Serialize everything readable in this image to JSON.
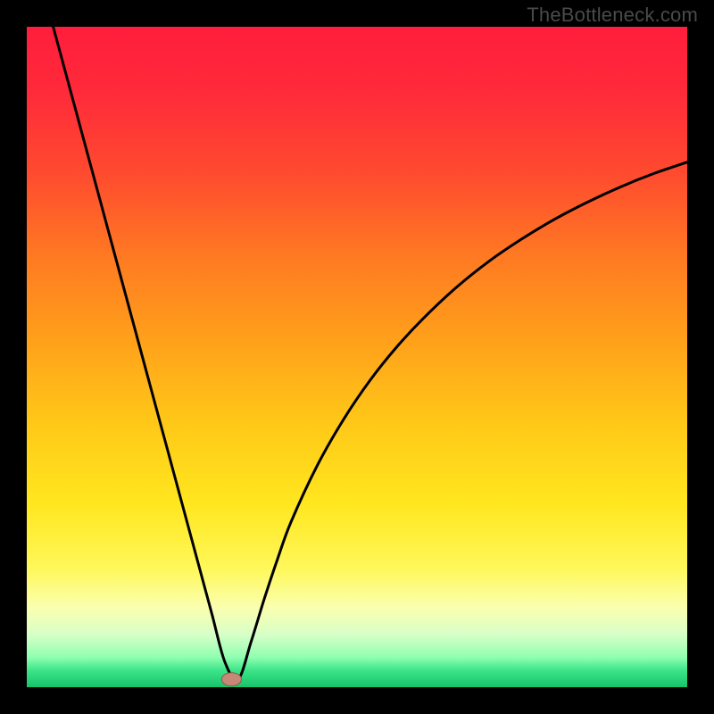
{
  "watermark": "TheBottleneck.com",
  "colors": {
    "gradient_stops": [
      {
        "offset": 0.0,
        "color": "#ff1e3c"
      },
      {
        "offset": 0.1,
        "color": "#ff2a3a"
      },
      {
        "offset": 0.22,
        "color": "#ff4a2f"
      },
      {
        "offset": 0.35,
        "color": "#ff7a22"
      },
      {
        "offset": 0.48,
        "color": "#ffa21a"
      },
      {
        "offset": 0.6,
        "color": "#ffc818"
      },
      {
        "offset": 0.72,
        "color": "#ffe61e"
      },
      {
        "offset": 0.82,
        "color": "#fff85a"
      },
      {
        "offset": 0.88,
        "color": "#faffb0"
      },
      {
        "offset": 0.92,
        "color": "#d8ffc8"
      },
      {
        "offset": 0.955,
        "color": "#8effb0"
      },
      {
        "offset": 0.975,
        "color": "#3be488"
      },
      {
        "offset": 1.0,
        "color": "#17c36b"
      }
    ],
    "curve": "#000000",
    "marker_fill": "#c88878",
    "marker_stroke": "#8e5a4a",
    "background": "#000000"
  },
  "chart_data": {
    "type": "line",
    "title": "",
    "xlabel": "",
    "ylabel": "",
    "xlim": [
      0,
      100
    ],
    "ylim": [
      0,
      100
    ],
    "grid": false,
    "legend_position": "none",
    "series": [
      {
        "name": "bottleneck-curve",
        "x": [
          4,
          6,
          8,
          10,
          12,
          14,
          16,
          18,
          20,
          22,
          24,
          26,
          28,
          30,
          32,
          34,
          36,
          38,
          40,
          44,
          48,
          52,
          56,
          60,
          65,
          70,
          75,
          80,
          85,
          90,
          95,
          100
        ],
        "y": [
          100,
          92.6,
          85.2,
          77.8,
          70.4,
          63.0,
          55.6,
          48.2,
          40.8,
          33.4,
          26.0,
          18.6,
          11.2,
          3.8,
          1.2,
          7.0,
          13.5,
          19.5,
          25.0,
          33.6,
          40.6,
          46.5,
          51.5,
          55.8,
          60.5,
          64.5,
          67.9,
          70.9,
          73.5,
          75.8,
          77.8,
          79.5
        ]
      }
    ],
    "marker": {
      "x": 31,
      "y": 1.2,
      "rx": 1.5,
      "ry": 1.0
    },
    "annotations": []
  }
}
